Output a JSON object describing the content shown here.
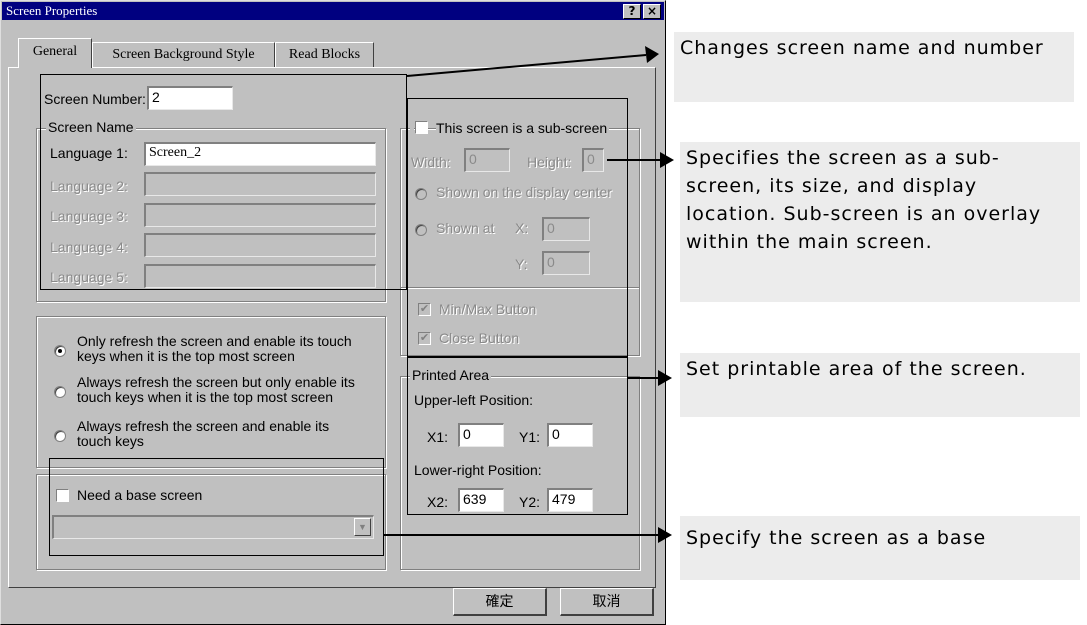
{
  "window": {
    "title": "Screen Properties",
    "help_btn": "?",
    "close_btn": "×"
  },
  "tabs": [
    {
      "label": "General"
    },
    {
      "label": "Screen Background Style"
    },
    {
      "label": "Read Blocks"
    }
  ],
  "general": {
    "screen_number_label": "Screen Number:",
    "screen_number_value": "2",
    "screen_name_group": "Screen Name",
    "languages": [
      {
        "label": "Language 1:",
        "value": "Screen_2"
      },
      {
        "label": "Language 2:",
        "value": ""
      },
      {
        "label": "Language 3:",
        "value": ""
      },
      {
        "label": "Language 4:",
        "value": ""
      },
      {
        "label": "Language 5:",
        "value": ""
      }
    ],
    "refresh_options": [
      {
        "line1": "Only refresh the screen and enable its touch",
        "line2": "keys when it is the top most screen",
        "selected": true
      },
      {
        "line1": "Always refresh the screen but only enable its",
        "line2": "touch keys when it is the top most screen",
        "selected": false
      },
      {
        "line1": "Always refresh the screen and enable its",
        "line2": "touch keys",
        "selected": false
      }
    ],
    "base_screen_label": "Need a base screen",
    "base_screen_checked": false,
    "base_screen_value": ""
  },
  "subscreen": {
    "checkbox_label": "This screen is a sub-screen",
    "checked": false,
    "width_label": "Width:",
    "width_value": "0",
    "height_label": "Height:",
    "height_value": "0",
    "center_label": "Shown on the display center",
    "shown_at_label": "Shown at",
    "x_label": "X:",
    "x_value": "0",
    "y_label": "Y:",
    "y_value": "0",
    "minmax_label": "Min/Max Button",
    "minmax_checked": true,
    "close_label": "Close Button",
    "close_checked": true
  },
  "printed_area": {
    "group": "Printed Area",
    "upper_left_label": "Upper-left Position:",
    "x1_label": "X1:",
    "x1_value": "0",
    "y1_label": "Y1:",
    "y1_value": "0",
    "lower_right_label": "Lower-right Position:",
    "x2_label": "X2:",
    "x2_value": "639",
    "y2_label": "Y2:",
    "y2_value": "479"
  },
  "buttons": {
    "ok": "確定",
    "cancel": "取消"
  },
  "annotations": {
    "name_number": "Changes screen name and number",
    "subscreen": "Specifies the screen as a sub-screen, its size, and display location. Sub-screen is an overlay within the main screen.",
    "printable": "Set printable area of the screen.",
    "base": "Specify the screen as a base"
  },
  "check_mark": "✔",
  "dropdown_arrow": "▼",
  "colors": {
    "titlebar": "#000080",
    "dialog_face": "#c0c0c0",
    "annotation_bg": "#ececec"
  }
}
